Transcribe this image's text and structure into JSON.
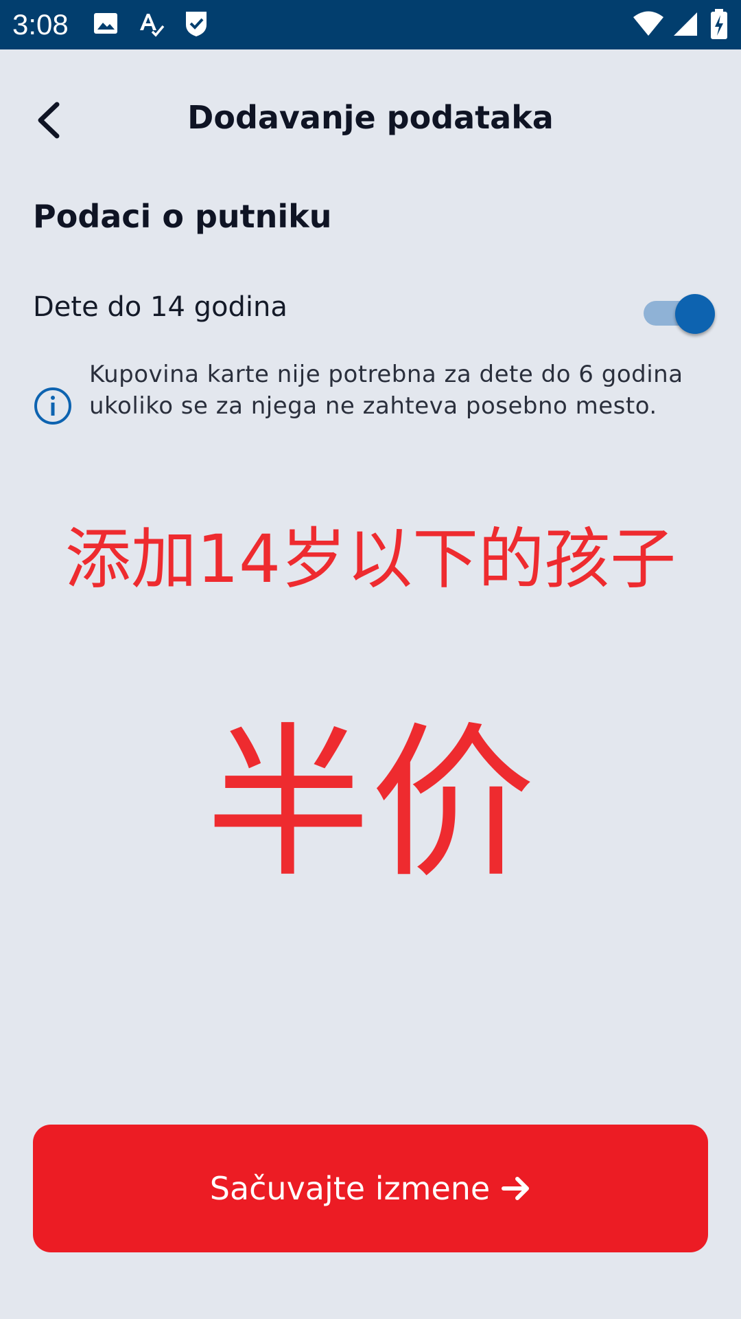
{
  "status_bar": {
    "time": "3:08",
    "left_icons": [
      "image-icon",
      "text-check-icon",
      "shield-check-icon"
    ],
    "right_icons": [
      "wifi-icon",
      "signal-icon",
      "battery-charging-icon"
    ],
    "background": "#023e6e"
  },
  "header": {
    "title": "Dodavanje podataka",
    "back_icon": "chevron-left-icon"
  },
  "section": {
    "title": "Podaci o putniku"
  },
  "child_toggle": {
    "label": "Dete do 14 godina",
    "checked": true,
    "accent": "#0d63b0"
  },
  "info": {
    "icon": "info-icon",
    "text": "Kupovina karte nije potrebna za dete do 6 godina ukoliko se za njega ne zahteva posebno mesto."
  },
  "overlay": {
    "line1": "添加14岁以下的孩子",
    "line2": "半价",
    "color": "#ee2b2f"
  },
  "save_button": {
    "label": "Sačuvajte izmene",
    "icon": "arrow-right-icon",
    "background": "#ec1c24"
  }
}
